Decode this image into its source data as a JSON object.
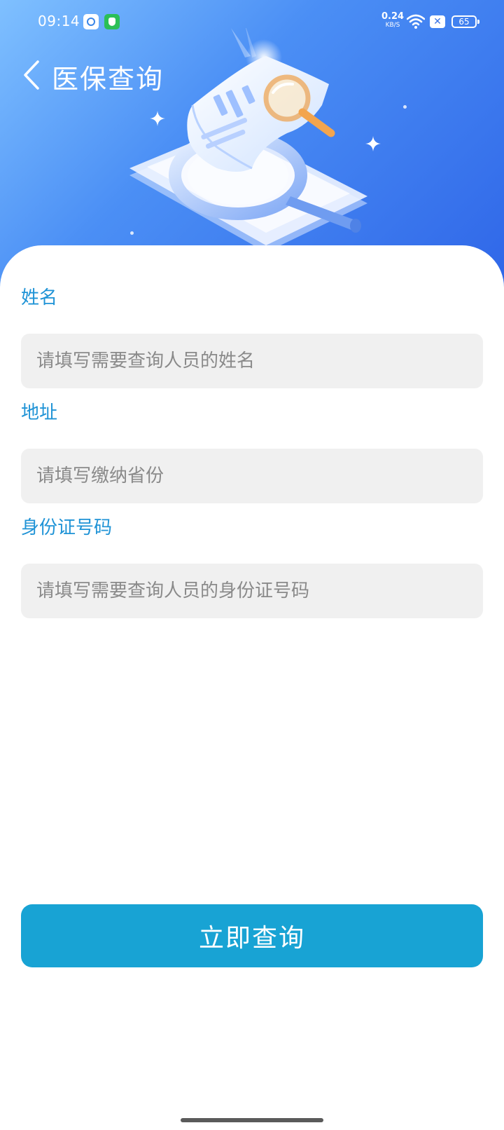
{
  "status_bar": {
    "time": "09:14",
    "net_speed_value": "0.24",
    "net_speed_unit": "KB/S",
    "battery": "65"
  },
  "header": {
    "title": "医保查询",
    "back_icon": "chevron-left-icon",
    "illustration": "document-magnifier-illustration"
  },
  "form": {
    "name": {
      "label": "姓名",
      "placeholder": "请填写需要查询人员的姓名"
    },
    "address": {
      "label": "地址",
      "placeholder": "请填写缴纳省份"
    },
    "id_number": {
      "label": "身份证号码",
      "placeholder": "请填写需要查询人员的身份证号码"
    }
  },
  "submit": {
    "label": "立即查询"
  },
  "colors": {
    "accent": "#1f93d6",
    "button": "#18a3d4",
    "banner_start": "#7fc0ff",
    "banner_end": "#2f66e8",
    "input_bg": "#f0f0f0"
  }
}
